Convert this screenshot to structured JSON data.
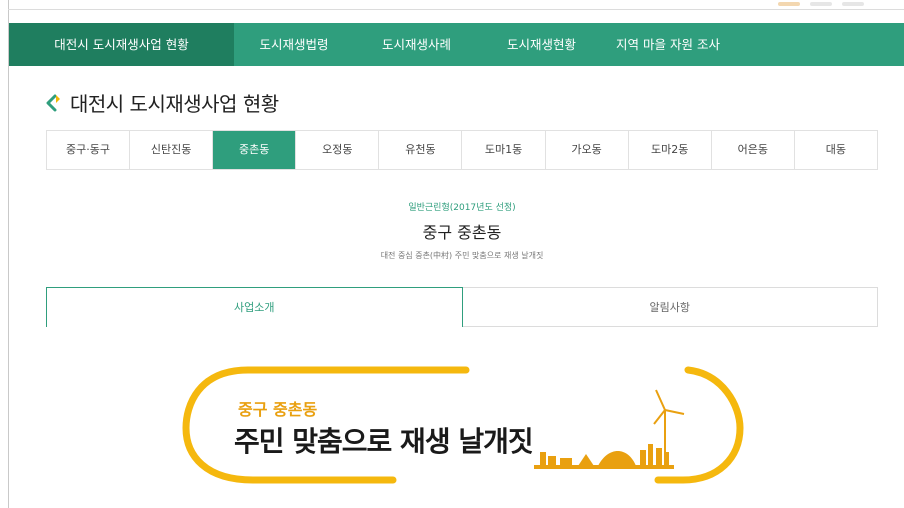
{
  "gnb": {
    "items": [
      {
        "label": "대전시 도시재생사업 현황"
      },
      {
        "label": "도시재생법령"
      },
      {
        "label": "도시재생사례"
      },
      {
        "label": "도시재생현황"
      },
      {
        "label": "지역 마을 자원 조사"
      }
    ]
  },
  "page": {
    "title": "대전시 도시재생사업 현황"
  },
  "districts": [
    "중구·동구",
    "신탄진동",
    "중촌동",
    "오정동",
    "유천동",
    "도마1동",
    "가오동",
    "도마2동",
    "어은동",
    "대동"
  ],
  "project": {
    "type": "일반근린형(2017년도 선정)",
    "name": "중구 중촌동",
    "slogan": "대전 중심 중촌(中村) 주민 맞춤으로 재생 날개짓"
  },
  "content_tabs": {
    "intro": "사업소개",
    "notice": "알림사항"
  },
  "banner": {
    "sub": "중구 중촌동",
    "main": "주민 맞춤으로 재생 날개짓"
  },
  "colors": {
    "primary": "#2f9e7d",
    "primary_dark": "#1f7e5f",
    "banner_accent": "#f5b80e"
  }
}
